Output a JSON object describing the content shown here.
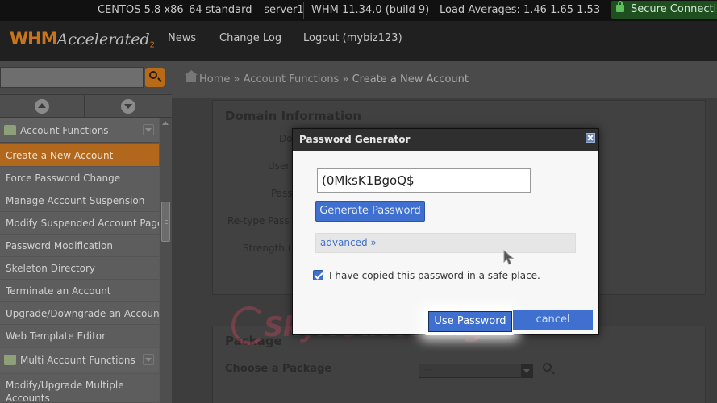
{
  "statusbar": {
    "os": "CENTOS 5.8 x86_64 standard – server1",
    "version": "WHM 11.34.0 (build 9)",
    "load": "Load Averages: 1.46 1.65 1.53",
    "secure": "Secure Connection"
  },
  "header": {
    "logo_whm": "WHM",
    "logo_accelerated": "Accelerated",
    "logo_two": "2",
    "nav": [
      "News",
      "Change Log",
      "Logout (mybiz123)"
    ]
  },
  "sidebar": {
    "section1": "Account Functions",
    "items": [
      "Create a New Account",
      "Force Password Change",
      "Manage Account Suspension",
      "Modify Suspended Account Page",
      "Password Modification",
      "Skeleton Directory",
      "Terminate an Account",
      "Upgrade/Downgrade an Account",
      "Web Template Editor"
    ],
    "section2": "Multi Account Functions",
    "items2": [
      "Modify/Upgrade Multiple Accounts"
    ]
  },
  "breadcrumb": {
    "home": "Home",
    "sep": "»",
    "level1": "Account Functions",
    "current": "Create a New Account"
  },
  "domain_panel": {
    "title": "Domain Information",
    "labels": [
      "Do",
      "User",
      "Pass",
      "Re-type Pass",
      "Strength ("
    ]
  },
  "package_panel": {
    "title": "Package",
    "choose": "Choose a Package",
    "selected": "---"
  },
  "watermark": "SkyNetHosting",
  "dialog": {
    "title": "Password Generator",
    "password": "(0MksK1BgoQ$",
    "generate": "Generate Password",
    "advanced": "advanced »",
    "copied_label": "I have copied this password in a safe place.",
    "copied_checked": true,
    "use_password": "Use Password",
    "cancel": "cancel"
  },
  "colors": {
    "accent_orange": "#b2681c",
    "button_blue": "#3f6fcf",
    "secure_green": "#1f4e1f"
  }
}
